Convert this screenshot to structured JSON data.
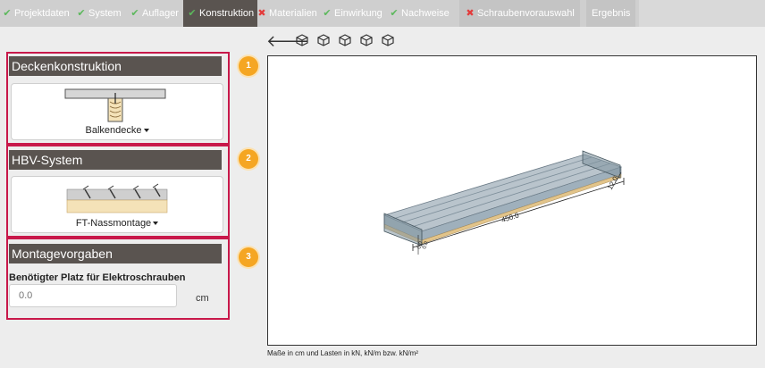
{
  "nav": {
    "tabs": [
      {
        "label": "Projektdaten",
        "status": "ok"
      },
      {
        "label": "System",
        "status": "ok"
      },
      {
        "label": "Auflager",
        "status": "ok"
      },
      {
        "label": "Konstruktion",
        "status": "active"
      },
      {
        "label": "Materialien",
        "status": "error"
      },
      {
        "label": "Einwirkung",
        "status": "ok"
      },
      {
        "label": "Nachweise",
        "status": "ok"
      },
      {
        "label": "Schraubenvorauswahl",
        "status": "error"
      },
      {
        "label": "Ergebnis",
        "status": "none"
      }
    ]
  },
  "sections": {
    "deck": {
      "title": "Deckenkonstruktion",
      "badge": "1",
      "selection": "Balkendecke"
    },
    "hbv": {
      "title": "HBV-System",
      "badge": "2",
      "selection": "FT-Nassmontage"
    },
    "mounting": {
      "title": "Montagevorgaben",
      "badge": "3",
      "field_label": "Benötigter Platz für Elektroschrauben",
      "field_placeholder": "0.0",
      "field_unit": "cm"
    }
  },
  "toolbar": {
    "icons": [
      "back-arrow-icon",
      "cube-view-icon",
      "cube-front-icon",
      "cube-side-icon",
      "cube-top-icon",
      "cube-iso-icon"
    ]
  },
  "model": {
    "dim_length": "450.0",
    "dim_height": "12.0",
    "dim_small_a": "0.0",
    "dim_small_b": "0.0"
  },
  "footnote": "Maße in cm und Lasten in kN, kN/m bzw. kN/m²",
  "colors": {
    "accent_header": "#5a5450",
    "section_border": "#c8184a",
    "badge": "#f5a623",
    "ok": "#5cb85c",
    "error": "#e33b3b"
  }
}
